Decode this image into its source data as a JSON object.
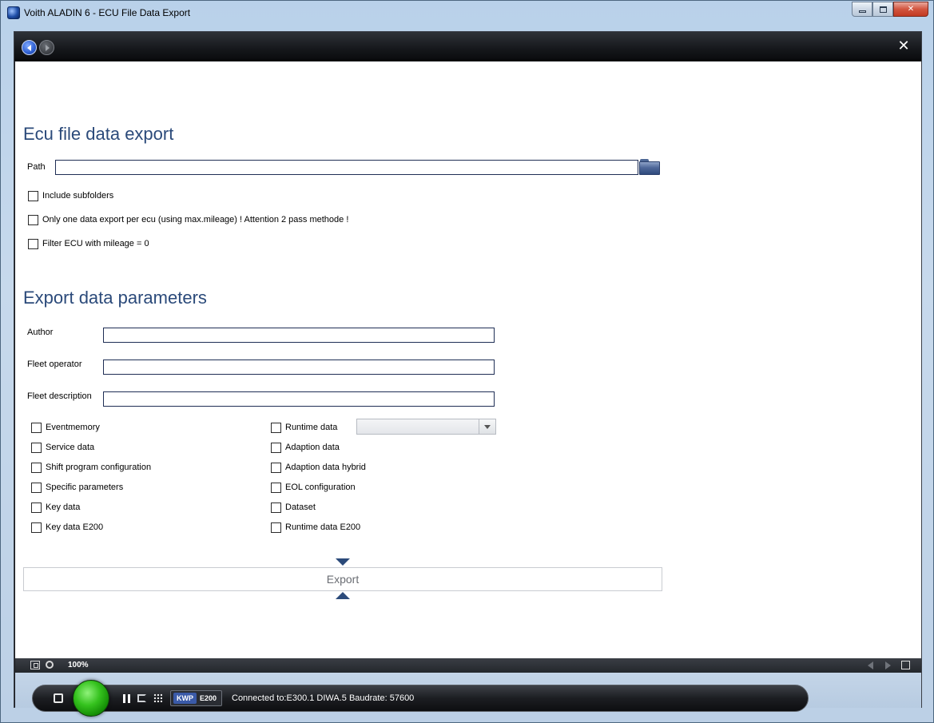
{
  "window": {
    "title": "Voith ALADIN 6 - ECU File Data Export",
    "min_label": "",
    "max_label": "",
    "close_label": "✕"
  },
  "app": {
    "close_label": "✕"
  },
  "section1": {
    "heading": "Ecu file data export",
    "path_label": "Path",
    "path_value": "",
    "checkboxes": [
      {
        "label": "Include subfolders",
        "checked": false
      },
      {
        "label": "Only one data export per ecu (using max.mileage) ! Attention 2 pass methode !",
        "checked": false
      },
      {
        "label": "Filter ECU with mileage = 0",
        "checked": false
      }
    ]
  },
  "section2": {
    "heading": "Export data parameters",
    "author_label": "Author",
    "author_value": "",
    "fleet_operator_label": "Fleet operator",
    "fleet_operator_value": "",
    "fleet_description_label": "Fleet description",
    "fleet_description_value": "",
    "left_options": [
      {
        "label": "Eventmemory",
        "checked": false
      },
      {
        "label": "Service data",
        "checked": false
      },
      {
        "label": "Shift program configuration",
        "checked": false
      },
      {
        "label": "Specific parameters",
        "checked": false
      },
      {
        "label": "Key data",
        "checked": false
      },
      {
        "label": "Key data E200",
        "checked": false
      }
    ],
    "right_options": [
      {
        "label": "Runtime data",
        "checked": false
      },
      {
        "label": "Adaption data",
        "checked": false
      },
      {
        "label": "Adaption data hybrid",
        "checked": false
      },
      {
        "label": "EOL configuration",
        "checked": false
      },
      {
        "label": "Dataset",
        "checked": false
      },
      {
        "label": "Runtime data E200",
        "checked": false
      }
    ],
    "runtime_select_value": ""
  },
  "export": {
    "button_label": "Export"
  },
  "bottombar": {
    "zoom": "100%"
  },
  "statusbar": {
    "protocol": "KWP",
    "ecu": "E200",
    "connection_text": "Connected to:E300.1  DIWA.5 Baudrate: 57600"
  },
  "icons": {
    "app": "voith-globe-icon",
    "back": "arrow-left-icon",
    "forward": "arrow-right-icon",
    "folder": "folder-icon",
    "led": "status-led-icon"
  },
  "colors": {
    "heading": "#2b4a7a",
    "status_led": "#35c21e",
    "kwp_badge": "#3a5aa8"
  }
}
